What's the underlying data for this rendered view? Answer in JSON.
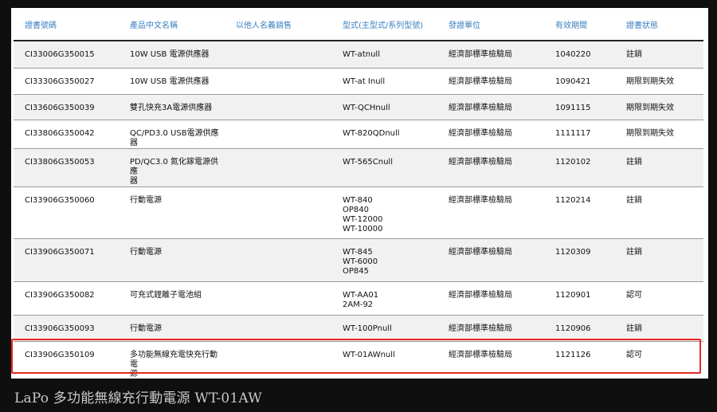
{
  "table": {
    "headers": [
      "證書號碼",
      "產品中文名稱",
      "以他人名義銷售",
      "型式(主型式/系列型號)",
      "發證單位",
      "有效期間",
      "證書狀態"
    ],
    "rows": [
      {
        "cert": "CI33006G350015",
        "name": [
          "10W USB 電源供應器"
        ],
        "other": "",
        "model": [
          "WT-atnull"
        ],
        "issuer": "經濟部標準檢驗局",
        "valid": "1040220",
        "status": "註銷"
      },
      {
        "cert": "CI33306G350027",
        "name": [
          "10W USB 電源供應器"
        ],
        "other": "",
        "model": [
          "WT-at Inull"
        ],
        "issuer": "經濟部標準檢驗局",
        "valid": "1090421",
        "status": "期限到期失效"
      },
      {
        "cert": "CI33606G350039",
        "name": [
          "雙孔快充3A電源供應器"
        ],
        "other": "",
        "model": [
          "WT-QCHnull"
        ],
        "issuer": "經濟部標準檢驗局",
        "valid": "1091115",
        "status": "期限到期失效"
      },
      {
        "cert": "CI33806G350042",
        "name": [
          "QC/PD3.0 USB電源供應器"
        ],
        "other": "",
        "model": [
          "WT-820QDnull"
        ],
        "issuer": "經濟部標準檢驗局",
        "valid": "1111117",
        "status": "期限到期失效"
      },
      {
        "cert": "CI33806G350053",
        "name": [
          "PD/QC3.0 氮化鎵電源供應",
          "器"
        ],
        "other": "",
        "model": [
          "WT-565Cnull"
        ],
        "issuer": "經濟部標準檢驗局",
        "valid": "1120102",
        "status": "註銷"
      },
      {
        "cert": "CI33906G350060",
        "name": [
          "行動電源"
        ],
        "other": "",
        "model": [
          "WT-840",
          "OP840",
          "WT-12000",
          "WT-10000"
        ],
        "issuer": "經濟部標準檢驗局",
        "valid": "1120214",
        "status": "註銷"
      },
      {
        "cert": "CI33906G350071",
        "name": [
          "行動電源"
        ],
        "other": "",
        "model": [
          "WT-845",
          "WT-6000",
          "OP845"
        ],
        "issuer": "經濟部標準檢驗局",
        "valid": "1120309",
        "status": "註銷"
      },
      {
        "cert": "CI33906G350082",
        "name": [
          "可充式鋰離子電池組"
        ],
        "other": "",
        "model": [
          "WT-AA01",
          "2AM-92"
        ],
        "issuer": "經濟部標準檢驗局",
        "valid": "1120901",
        "status": "認可"
      },
      {
        "cert": "CI33906G350093",
        "name": [
          "行動電源"
        ],
        "other": "",
        "model": [
          "WT-100Pnull"
        ],
        "issuer": "經濟部標準檢驗局",
        "valid": "1120906",
        "status": "註銷"
      },
      {
        "cert": "CI33906G350109",
        "name": [
          "多功能無線充電快充行動電",
          "源"
        ],
        "other": "",
        "model": [
          "WT-01AWnull"
        ],
        "issuer": "經濟部標準檢驗局",
        "valid": "1121126",
        "status": "認可"
      }
    ]
  },
  "caption": "LaPo 多功能無線充行動電源 WT-01AW",
  "colors": {
    "header_text": "#3a7fc0",
    "highlight": "#e8271f",
    "background": "#0f0f0f"
  }
}
